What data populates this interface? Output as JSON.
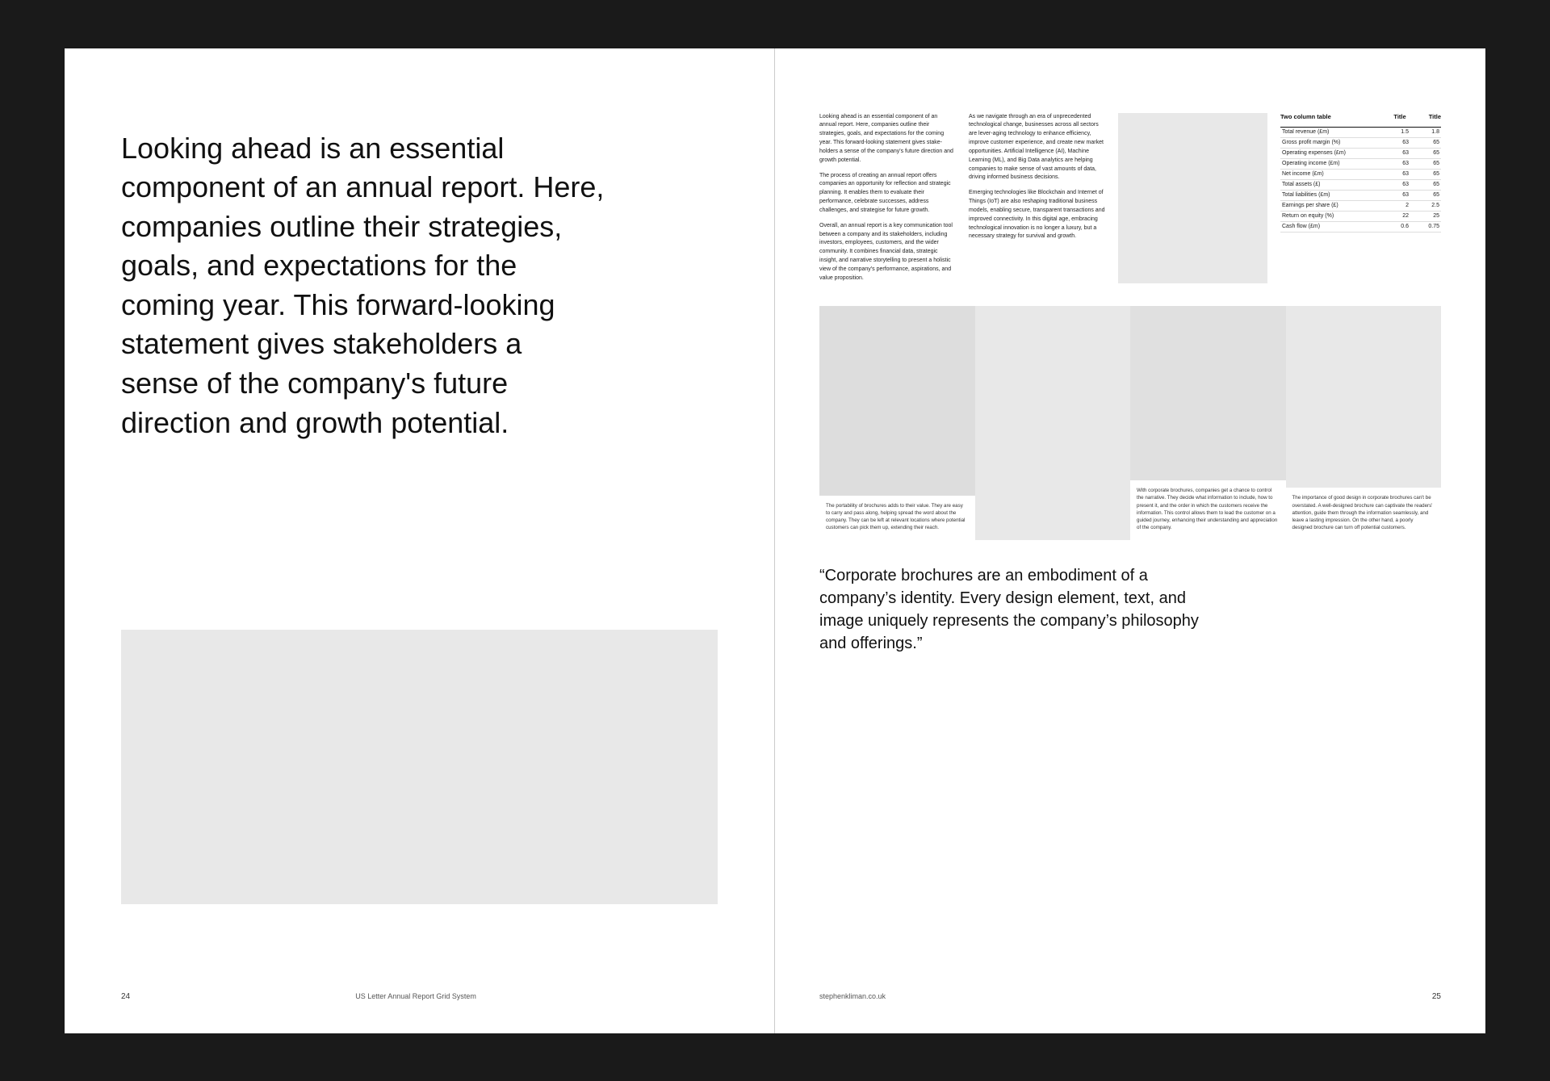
{
  "pages": {
    "left": {
      "hero_text": "Looking ahead is an essential component of an annual report. Here, companies outline their strategies, goals, and expectations for the coming year. This forward-looking statement gives stakeholders a sense of the company's future direction and growth potential.",
      "page_number": "24",
      "footer_center": "US Letter Annual Report Grid System"
    },
    "right": {
      "col1": {
        "p1": "Looking ahead is an essential component of an annual report. Here, companies outline their strategies, goals, and expectations for the coming year. This forward-looking statement gives stake-holders a sense of the company's future direction and growth potential.",
        "p2": "The process of creating an annual report offers companies an opportunity for reflection and strategic planning. It enables them to evaluate their performance, celebrate successes, address challenges, and strategise for future growth.",
        "p3": "Overall, an annual report is a key communication tool between a company and its stakeholders, including investors, employees, customers, and the wider community. It combines financial data, strategic insight, and narrative storytelling to present a holistic view of the company's performance, aspirations, and value proposition."
      },
      "col2": {
        "p1": "As we navigate through an era of unprecedented technological change, businesses across all sectors are lever-aging technology to enhance efficiency, improve customer experience, and create new market opportunities. Artificial Intelligence (AI), Machine Learning (ML), and Big Data analytics are helping companies to make sense of vast amounts of data, driving informed business decisions.",
        "p2": "Emerging technologies like Blockchain and Internet of Things (IoT) are also reshaping traditional business models, enabling secure, transparent transactions and improved connectivity. In this digital age, embracing technological innovation is no longer a luxury, but a necessary strategy for survival and growth."
      },
      "table": {
        "title": "Two column table",
        "col1_header": "",
        "col2_header": "Title",
        "col3_header": "Title",
        "rows": [
          {
            "label": "Total revenue (£m)",
            "val1": "1.5",
            "val2": "1.8"
          },
          {
            "label": "Gross profit margin (%)",
            "val1": "63",
            "val2": "65"
          },
          {
            "label": "Operating expenses (£m)",
            "val1": "63",
            "val2": "65"
          },
          {
            "label": "Operating income (£m)",
            "val1": "63",
            "val2": "65"
          },
          {
            "label": "Net income (£m)",
            "val1": "63",
            "val2": "65"
          },
          {
            "label": "Total assets (£)",
            "val1": "63",
            "val2": "65"
          },
          {
            "label": "Total liabilities (£m)",
            "val1": "63",
            "val2": "65"
          },
          {
            "label": "Earnings per share (£)",
            "val1": "2",
            "val2": "2.5"
          },
          {
            "label": "Return on equity (%)",
            "val1": "22",
            "val2": "25"
          },
          {
            "label": "Cash flow (£m)",
            "val1": "0.6",
            "val2": "0.75"
          }
        ]
      },
      "img_captions": {
        "cap1": "The portability of brochures adds to their value. They are easy to carry and pass along, helping spread the word about the company. They can be left at relevant locations where potential customers can pick them up, extending their reach.",
        "cap2": "With corporate brochures, companies get a chance to control the narrative. They decide what information to include, how to present it, and the order in which the customers receive the information. This control allows them to lead the customer on a guided journey, enhancing their understanding and appreciation of the company.",
        "cap3": "The importance of good design in corporate brochures can't be overstated. A well-designed brochure can captivate the readers' attention, guide them through the information seamlessly, and leave a lasting impression. On the other hand, a poorly designed brochure can turn off potential customers."
      },
      "quote": "“Corporate brochures are an embodiment of a company’s identity. Every design element, text, and image uniquely represents the company’s philosophy and offerings.”",
      "page_number": "25",
      "footer_website": "stephenkliman.co.uk"
    }
  }
}
